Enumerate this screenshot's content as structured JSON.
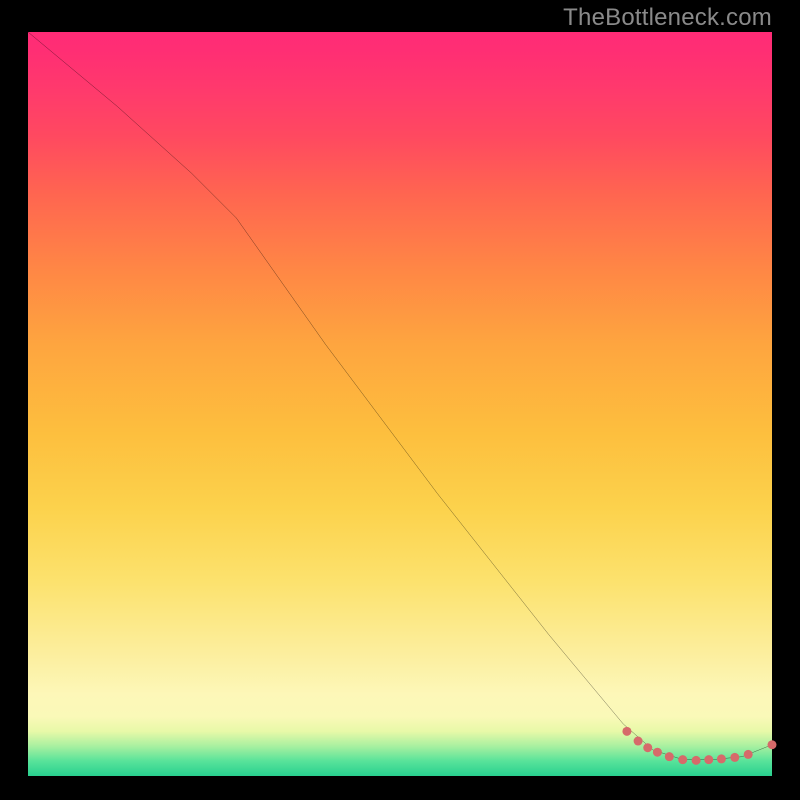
{
  "attribution": "TheBottleneck.com",
  "chart_data": {
    "type": "line",
    "title": "",
    "xlabel": "",
    "ylabel": "",
    "xlim": [
      0,
      100
    ],
    "ylim": [
      0,
      100
    ],
    "curve": {
      "description": "bottleneck curve — steep decline from 100 at x=0, slight knee around x≈25, then near-linear descent to a minimum near x≈88, followed by a slight uptick to x=100",
      "points": [
        {
          "x": 0,
          "y": 100
        },
        {
          "x": 12,
          "y": 90
        },
        {
          "x": 22,
          "y": 81
        },
        {
          "x": 28,
          "y": 75
        },
        {
          "x": 40,
          "y": 58
        },
        {
          "x": 55,
          "y": 38
        },
        {
          "x": 70,
          "y": 19
        },
        {
          "x": 80,
          "y": 7
        },
        {
          "x": 84,
          "y": 3.5
        },
        {
          "x": 88,
          "y": 2.2
        },
        {
          "x": 92,
          "y": 2.2
        },
        {
          "x": 96,
          "y": 2.6
        },
        {
          "x": 100,
          "y": 4.2
        }
      ]
    },
    "markers": {
      "color": "#d66a6a",
      "radius": 4.5,
      "points": [
        {
          "x": 80.5,
          "y": 6.0
        },
        {
          "x": 82.0,
          "y": 4.7
        },
        {
          "x": 83.3,
          "y": 3.8
        },
        {
          "x": 84.6,
          "y": 3.2
        },
        {
          "x": 86.2,
          "y": 2.6
        },
        {
          "x": 88.0,
          "y": 2.2
        },
        {
          "x": 89.8,
          "y": 2.1
        },
        {
          "x": 91.5,
          "y": 2.2
        },
        {
          "x": 93.2,
          "y": 2.3
        },
        {
          "x": 95.0,
          "y": 2.5
        },
        {
          "x": 96.8,
          "y": 2.9
        },
        {
          "x": 100.0,
          "y": 4.2
        }
      ]
    },
    "gradient_stops": [
      {
        "pct": 0,
        "color": "#28d08f"
      },
      {
        "pct": 4,
        "color": "#a8f0a0"
      },
      {
        "pct": 8,
        "color": "#faf9b8"
      },
      {
        "pct": 16,
        "color": "#fcefa0"
      },
      {
        "pct": 36,
        "color": "#fcd24c"
      },
      {
        "pct": 58,
        "color": "#fea53f"
      },
      {
        "pct": 78,
        "color": "#ff6650"
      },
      {
        "pct": 92,
        "color": "#ff3a6c"
      },
      {
        "pct": 100,
        "color": "#ff2b77"
      }
    ]
  },
  "colors": {
    "frame_bg": "#000000",
    "attribution_text": "#8a8a8a",
    "curve_stroke": "#000000",
    "marker_fill": "#d66a6a"
  }
}
